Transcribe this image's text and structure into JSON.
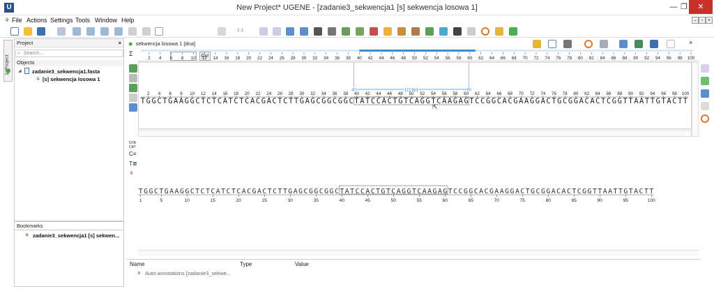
{
  "window": {
    "app_logo": "U",
    "title": "New Project* UGENE - [zadanie3_sekwencja1 [s] sekwencja losowa 1]",
    "minimize": "—",
    "restore": "❐",
    "close": "✕"
  },
  "menu": [
    "File",
    "Actions",
    "Settings",
    "Tools",
    "Window",
    "Help"
  ],
  "toolbar": {
    "goto_value": "",
    "goto_button": "Go!",
    "zoom_label": "1:1"
  },
  "sidebar_tab": "1: Project",
  "project": {
    "title": "Project",
    "close": "×",
    "search_placeholder": "Search...",
    "objects_label": "Objects",
    "file": "zadanie3_sekwencja1.fasta",
    "sequence": "[s] sekwencja losowa 1"
  },
  "bookmarks": {
    "title": "Bookmarks",
    "item": "zadanie3_sekwencja1 [s] sekwen..."
  },
  "view": {
    "tab_title": "sekwencja losowa 1 [dna]",
    "close": "×"
  },
  "sequence": "TGGCTGAAGGCTCTCATCTCACGACTCTTGAGCGGCGGCTATCCACTGTCAGGTCAAGAGTCCGGCACGAAGGACTGCGGACACTCGGTTAATTGTACTT",
  "selection": {
    "start": 40,
    "end": 60,
    "length_label": "[21 bp]"
  },
  "overview_ticks": [
    2,
    4,
    6,
    8,
    10,
    12,
    14,
    16,
    18,
    20,
    22,
    24,
    26,
    28,
    30,
    32,
    34,
    36,
    38,
    40,
    42,
    44,
    46,
    48,
    50,
    52,
    54,
    56,
    58,
    60,
    62,
    64,
    66,
    68,
    70,
    72,
    74,
    76,
    78,
    80,
    82,
    84,
    86,
    88,
    90,
    92,
    94,
    96,
    98,
    100
  ],
  "zoom_ticks": [
    1,
    5,
    10,
    15,
    20,
    25,
    30,
    35,
    40,
    45,
    50,
    55,
    60,
    65,
    70,
    75,
    80,
    85,
    90,
    95,
    100
  ],
  "annotations": {
    "col_name": "Name",
    "col_type": "Type",
    "col_value": "Value",
    "row": "Auto-annotations [zadanie3_sekwe..."
  },
  "colors": {
    "selection": "#3b8fd6",
    "accent": "#2b4f8e",
    "close_red": "#c9302c"
  }
}
